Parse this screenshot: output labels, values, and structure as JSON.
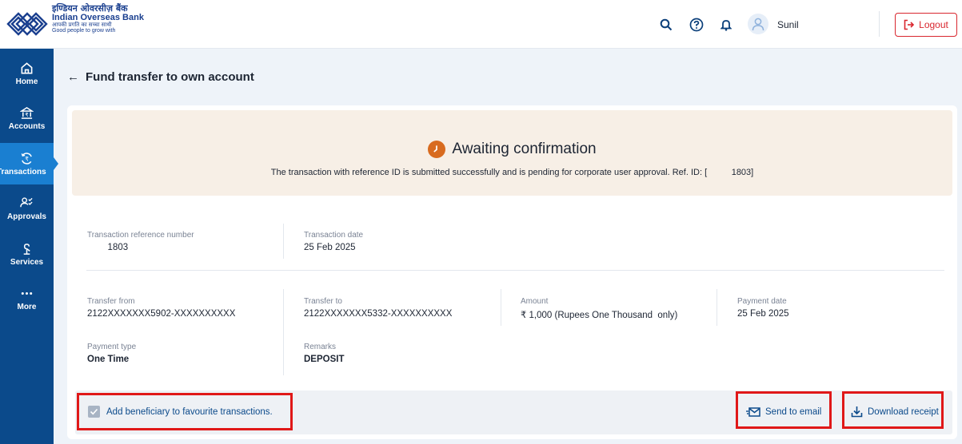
{
  "brand": {
    "hindi_name": "इण्डियन ओवरसीज़ बैंक",
    "english_name": "Indian Overseas Bank",
    "tagline_hindi": "आपकी प्रगति का सच्चा साथी",
    "tagline_english": "Good people to grow with"
  },
  "header": {
    "icons": [
      "search-icon",
      "help-icon",
      "bell-icon"
    ],
    "user_name": "Sunil",
    "logout_label": "Logout"
  },
  "sidebar": {
    "items": [
      {
        "label": "Home",
        "icon": "home-icon"
      },
      {
        "label": "Accounts",
        "icon": "bank-icon"
      },
      {
        "label": "Transactions",
        "icon": "rupee-exchange-icon",
        "active": true
      },
      {
        "label": "Approvals",
        "icon": "approvals-icon"
      },
      {
        "label": "Services",
        "icon": "services-icon"
      },
      {
        "label": "More",
        "icon": "more-icon"
      }
    ]
  },
  "page": {
    "title": "Fund transfer to own account"
  },
  "status": {
    "title": "Awaiting confirmation",
    "message": "The transaction with reference ID is submitted successfully and is pending for corporate user approval. Ref. ID: [          1803]"
  },
  "details": {
    "txn_ref": {
      "label": "Transaction reference number",
      "value": "        1803"
    },
    "txn_date": {
      "label": "Transaction date",
      "value": "25 Feb 2025"
    },
    "transfer_from": {
      "label": "Transfer from",
      "value": "2122XXXXXXX5902-XXXXXXXXXX"
    },
    "transfer_to": {
      "label": "Transfer to",
      "value": "2122XXXXXXX5332-XXXXXXXXXX"
    },
    "amount": {
      "label": "Amount",
      "value": "₹ 1,000 (Rupees One Thousand  only)"
    },
    "payment_date": {
      "label": "Payment date",
      "value": "25 Feb 2025"
    },
    "payment_type": {
      "label": "Payment type",
      "value": "One Time"
    },
    "remarks": {
      "label": "Remarks",
      "value": "DEPOSIT"
    }
  },
  "actions": {
    "favourite_label": "Add beneficiary to favourite transactions.",
    "favourite_checked": true,
    "email_label": "Send to email",
    "download_label": "Download receipt"
  },
  "colors": {
    "sidebar": "#0b4a8b",
    "sidebar_active": "#1a7fd1",
    "logout": "#d9262e",
    "status_icon": "#d86b1f",
    "highlight": "#e01818"
  }
}
